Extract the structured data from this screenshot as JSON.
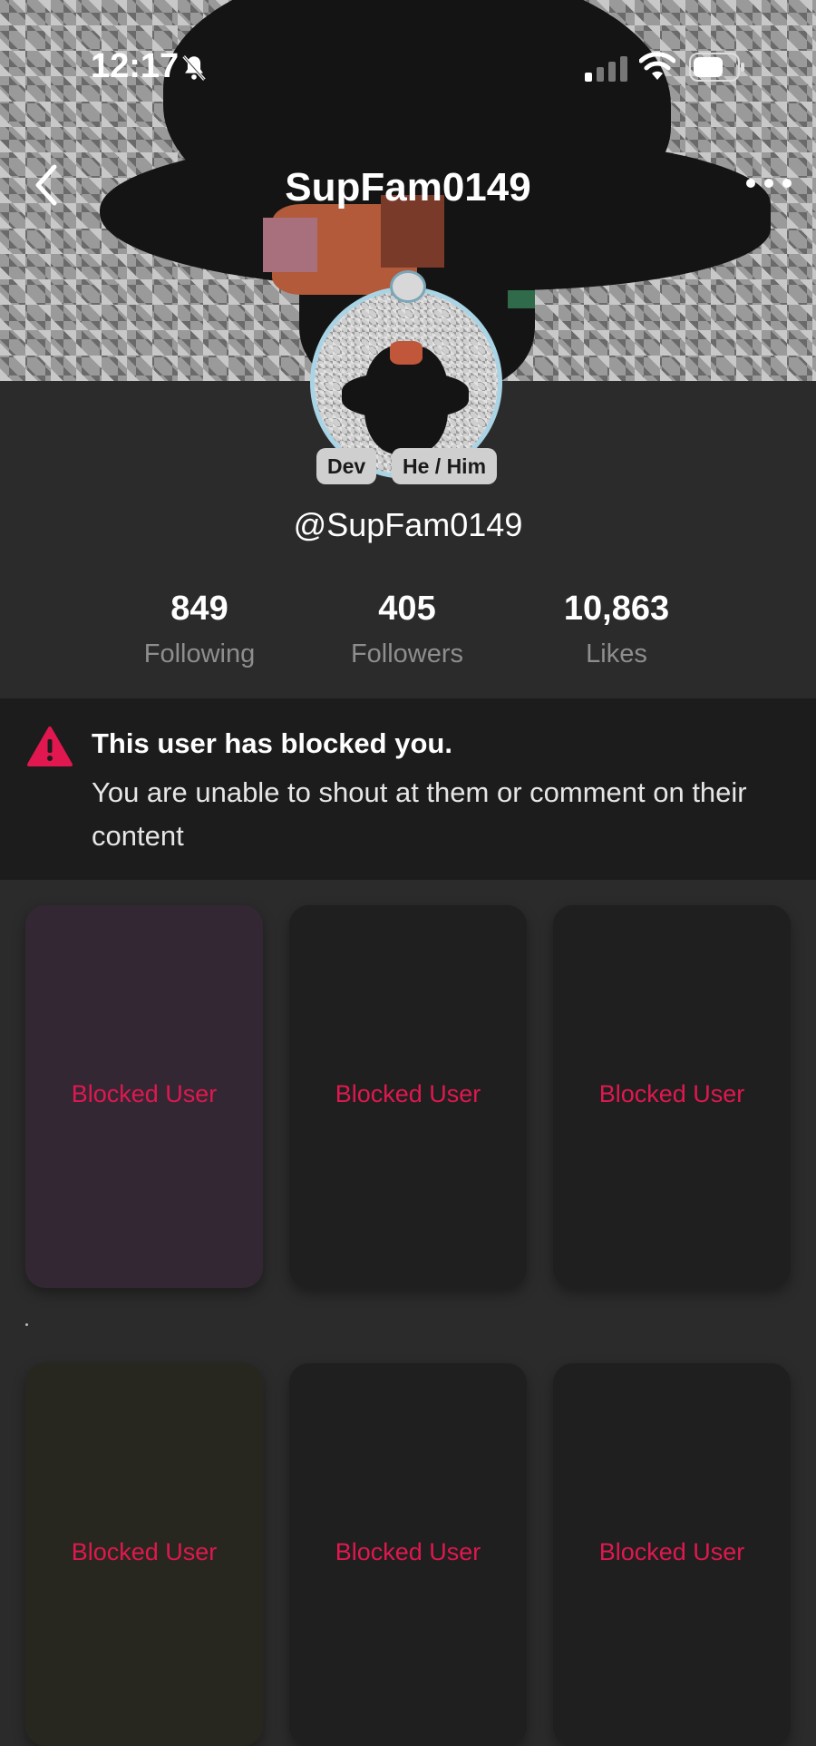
{
  "status_bar": {
    "time": "12:17"
  },
  "nav": {
    "title": "SupFam0149"
  },
  "profile": {
    "badges": [
      "Dev",
      "He / Him"
    ],
    "handle": "@SupFam0149",
    "stats": [
      {
        "value": "849",
        "label": "Following"
      },
      {
        "value": "405",
        "label": "Followers"
      },
      {
        "value": "10,863",
        "label": "Likes"
      }
    ]
  },
  "blocked_notice": {
    "title": "This user has blocked you.",
    "message": "You are unable to shout at them or comment on their content"
  },
  "content_grid": {
    "items": [
      {
        "label": "Blocked User"
      },
      {
        "label": "Blocked User"
      },
      {
        "label": "Blocked User"
      },
      {
        "label": "Blocked User"
      },
      {
        "label": "Blocked User"
      },
      {
        "label": "Blocked User"
      }
    ]
  },
  "colors": {
    "accent": "#e0184f",
    "background": "#2b2b2b",
    "banner": "#1c1c1c",
    "card": "#1f1f1f"
  },
  "icons": [
    "bell-off-icon",
    "signal-icon",
    "wifi-icon",
    "battery-icon",
    "back-icon",
    "more-icon",
    "warning-icon"
  ]
}
